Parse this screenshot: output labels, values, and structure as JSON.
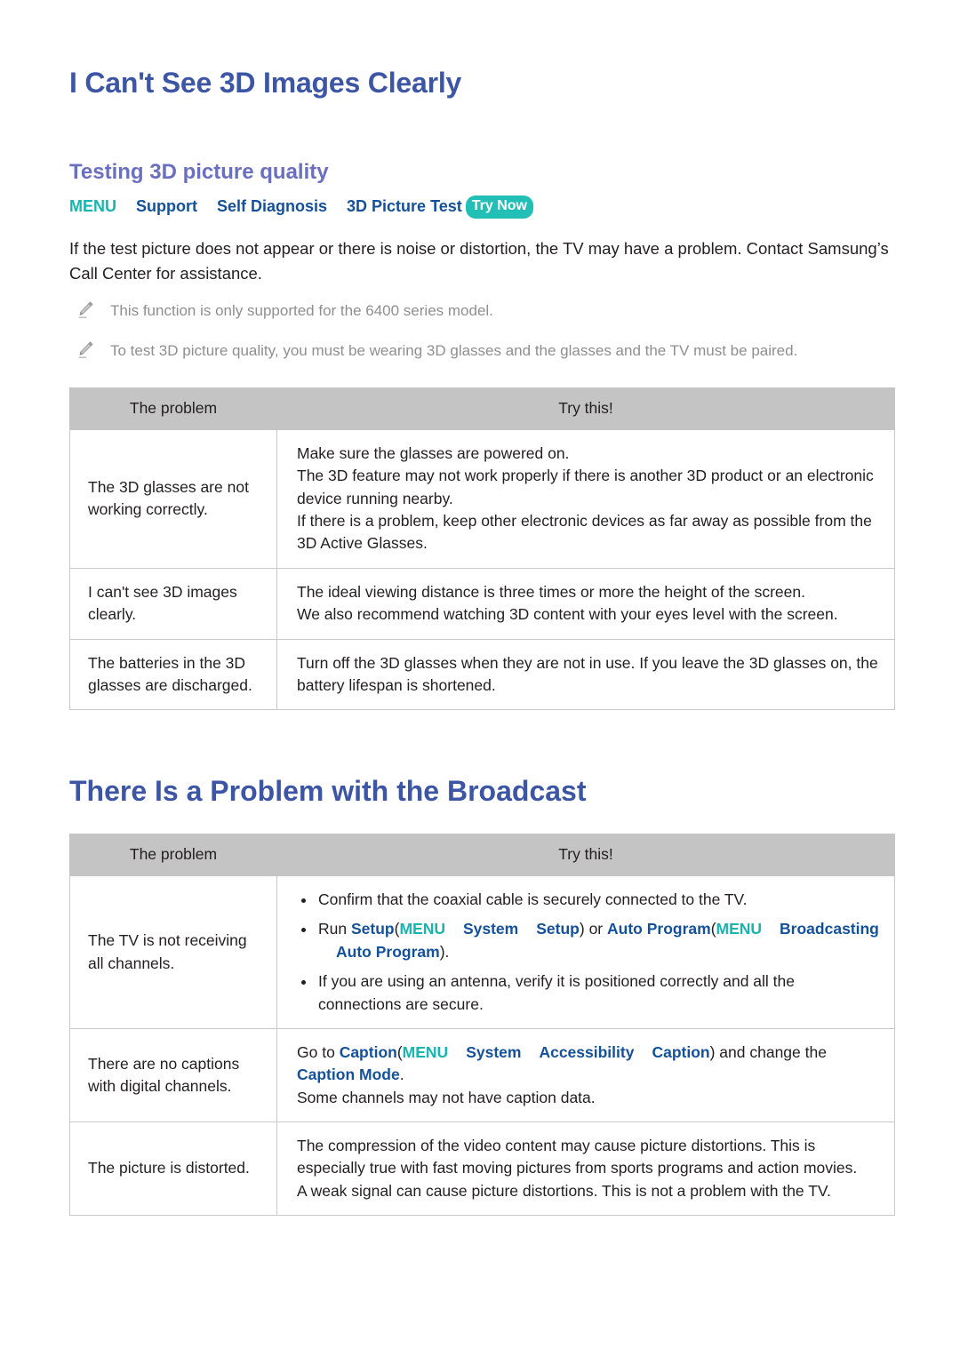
{
  "document": {
    "title": "I Can't See 3D Images Clearly",
    "section_title": "Testing 3D picture quality",
    "menu_path": {
      "menu_label": "MENU",
      "items": [
        "Support",
        "Self Diagnosis",
        "3D Picture Test"
      ],
      "try_now_label": "Try Now"
    },
    "intro_paragraph": "If the test picture does not appear or there is noise or distortion, the TV may have a problem. Contact Samsung’s Call Center for assistance.",
    "notes": [
      {
        "icon": "pencil-icon",
        "text": "This function is only supported for the 6400 series model."
      },
      {
        "icon": "pencil-icon",
        "text": "To test 3D picture quality, you must be wearing 3D glasses and the glasses and the TV must be paired."
      }
    ],
    "table_3d": {
      "headers": [
        "The problem",
        "Try this!"
      ],
      "rows": [
        {
          "problem": [
            "The 3D glasses are not",
            "working correctly."
          ],
          "try": [
            "Make sure the glasses are powered on.",
            "The 3D feature may not work properly if there is another 3D product or an electronic device running nearby.",
            "If there is a problem, keep other electronic devices as far away as possible from the 3D Active Glasses."
          ]
        },
        {
          "problem": [
            "I can't see 3D images",
            "clearly."
          ],
          "try": [
            "The ideal viewing distance is three times or more the height of the screen.",
            "We also recommend watching 3D content with your eyes level with the screen."
          ]
        },
        {
          "problem": [
            "The batteries in the 3D",
            "glasses are discharged."
          ],
          "try": [
            "Turn off the 3D glasses when they are not in use. If you leave the 3D glasses on, the battery lifespan is shortened."
          ]
        }
      ]
    },
    "title_2": "There Is a Problem with the Broadcast",
    "table_broadcast": {
      "headers": [
        "The problem",
        "Try this!"
      ],
      "row_tv": {
        "problem": [
          "The TV is not receiving",
          "all channels."
        ],
        "bullet_1": "Confirm that the coaxial cable is securely connected to the TV.",
        "bullet_2": {
          "run": "Run",
          "setup_link": "Setup",
          "open_paren": "(",
          "menu": "MENU",
          "system": "System",
          "setup": "Setup",
          "close_paren": ")",
          "or": "or",
          "auto_program_link": "Auto Program",
          "open_paren_2": "(",
          "menu_2": "MENU",
          "broadcasting": "Broadcasting",
          "auto_program": "Auto Program",
          "close_paren_2": ")",
          "period": "."
        },
        "bullet_3": "If you are using an antenna, verify it is positioned correctly and all the connections are secure."
      },
      "row_captions": {
        "problem": [
          "There are no captions",
          "with digital channels."
        ],
        "go_to": "Go to",
        "caption_link": "Caption",
        "open_paren": "(",
        "menu": "MENU",
        "system": "System",
        "accessibility": "Accessibility",
        "caption": "Caption",
        "close_paren": ")",
        "and_change": "and change the",
        "caption_mode": "Caption Mode",
        "period": ".",
        "line_2": "Some channels may not have caption data."
      },
      "row_distorted": {
        "problem": [
          "The picture is distorted."
        ],
        "try": [
          "The compression of the video content may cause picture distortions. This is especially true with fast moving pictures from sports programs and action movies.",
          "A weak signal can cause picture distortions. This is not a problem with the TV."
        ]
      }
    }
  },
  "colors": {
    "title_blue": "#3c56a5",
    "section_purple": "#6b6fc0",
    "link_blue": "#14519b",
    "menu_teal": "#16b5b0",
    "badge_teal": "#21bfb5",
    "table_header_gray": "#c4c4c4",
    "note_gray": "#8f8f8f"
  }
}
